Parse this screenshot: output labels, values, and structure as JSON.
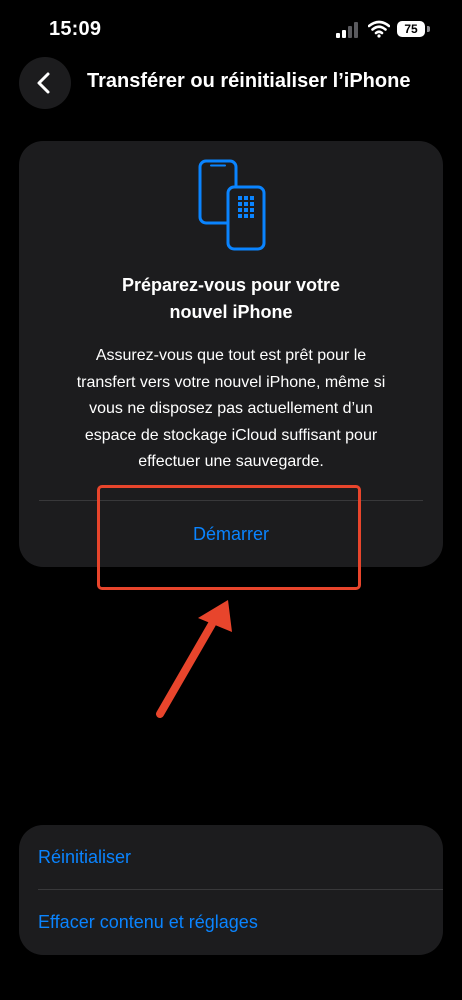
{
  "status_bar": {
    "time": "15:09",
    "battery_level": "75",
    "icons": [
      "signal-icon",
      "wifi-icon",
      "battery-icon"
    ]
  },
  "nav": {
    "back_icon": "chevron-left-icon",
    "title": "Transférer ou réinitialiser l’iPhone"
  },
  "prepare_card": {
    "icon": "devices-transfer-icon",
    "title_lines": [
      "Préparez-vous pour votre",
      "nouvel iPhone"
    ],
    "body_lines": [
      "Assurez-vous que tout est prêt pour le",
      "transfert vers votre nouvel iPhone, même si",
      "vous ne disposez pas actuellement d’un",
      "espace de stockage iCloud suffisant pour",
      "effectuer une sauvegarde."
    ],
    "start_label": "Démarrer"
  },
  "reset_card": {
    "items": [
      "Réinitialiser",
      "Effacer contenu et réglages"
    ]
  },
  "colors": {
    "background": "#000000",
    "card": "#1c1c1e",
    "accent_blue": "#0a84ff",
    "annotation_red": "#e8452c"
  }
}
